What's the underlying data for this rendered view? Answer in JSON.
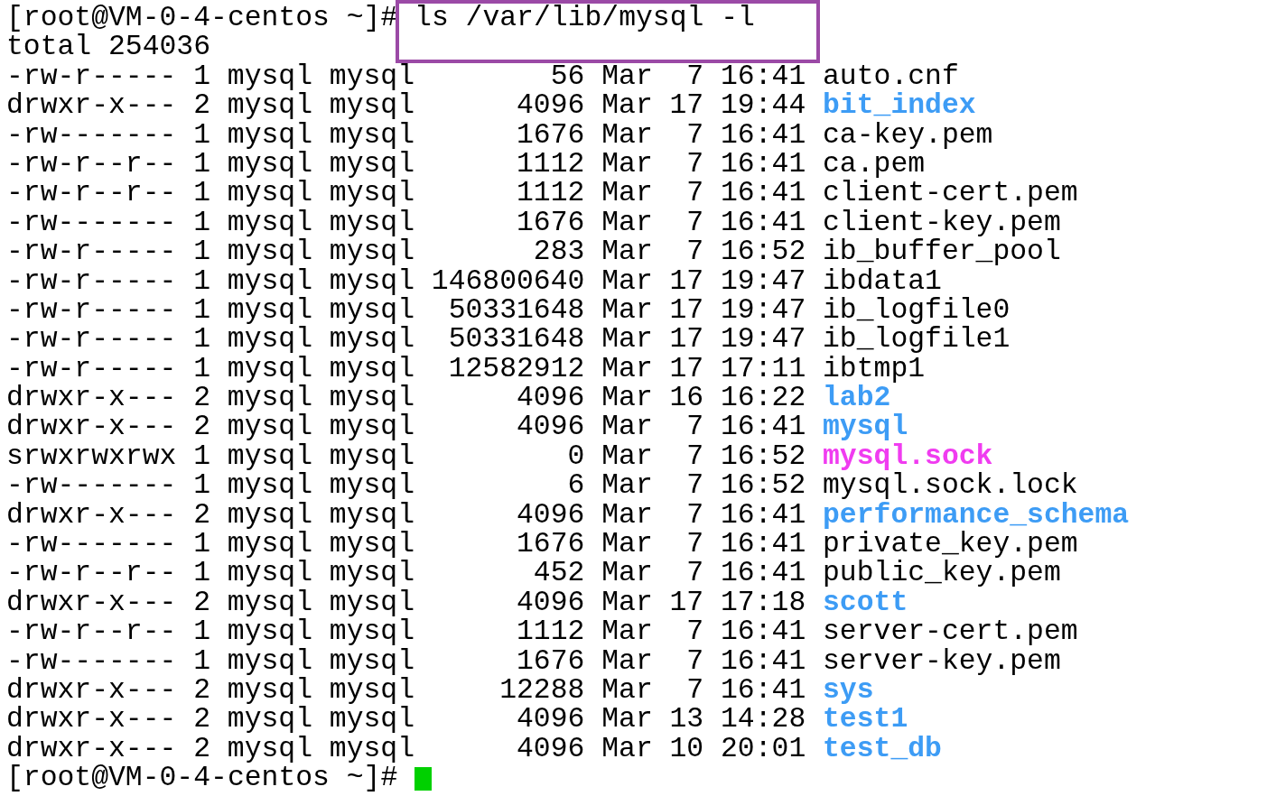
{
  "command_line": {
    "prompt": "[root@VM-0-4-centos ~]#",
    "command": "ls /var/lib/mysql -l",
    "highlighted": true
  },
  "total": "total 254036",
  "entries": [
    {
      "perms": "-rw-r-----",
      "links": "1",
      "owner": "mysql",
      "group": "mysql",
      "size": "56",
      "month": "Mar",
      "day": "7",
      "time": "16:41",
      "name": "auto.cnf",
      "kind": "file"
    },
    {
      "perms": "drwxr-x---",
      "links": "2",
      "owner": "mysql",
      "group": "mysql",
      "size": "4096",
      "month": "Mar",
      "day": "17",
      "time": "19:44",
      "name": "bit_index",
      "kind": "dir"
    },
    {
      "perms": "-rw-------",
      "links": "1",
      "owner": "mysql",
      "group": "mysql",
      "size": "1676",
      "month": "Mar",
      "day": "7",
      "time": "16:41",
      "name": "ca-key.pem",
      "kind": "file"
    },
    {
      "perms": "-rw-r--r--",
      "links": "1",
      "owner": "mysql",
      "group": "mysql",
      "size": "1112",
      "month": "Mar",
      "day": "7",
      "time": "16:41",
      "name": "ca.pem",
      "kind": "file"
    },
    {
      "perms": "-rw-r--r--",
      "links": "1",
      "owner": "mysql",
      "group": "mysql",
      "size": "1112",
      "month": "Mar",
      "day": "7",
      "time": "16:41",
      "name": "client-cert.pem",
      "kind": "file"
    },
    {
      "perms": "-rw-------",
      "links": "1",
      "owner": "mysql",
      "group": "mysql",
      "size": "1676",
      "month": "Mar",
      "day": "7",
      "time": "16:41",
      "name": "client-key.pem",
      "kind": "file"
    },
    {
      "perms": "-rw-r-----",
      "links": "1",
      "owner": "mysql",
      "group": "mysql",
      "size": "283",
      "month": "Mar",
      "day": "7",
      "time": "16:52",
      "name": "ib_buffer_pool",
      "kind": "file"
    },
    {
      "perms": "-rw-r-----",
      "links": "1",
      "owner": "mysql",
      "group": "mysql",
      "size": "146800640",
      "month": "Mar",
      "day": "17",
      "time": "19:47",
      "name": "ibdata1",
      "kind": "file"
    },
    {
      "perms": "-rw-r-----",
      "links": "1",
      "owner": "mysql",
      "group": "mysql",
      "size": "50331648",
      "month": "Mar",
      "day": "17",
      "time": "19:47",
      "name": "ib_logfile0",
      "kind": "file"
    },
    {
      "perms": "-rw-r-----",
      "links": "1",
      "owner": "mysql",
      "group": "mysql",
      "size": "50331648",
      "month": "Mar",
      "day": "17",
      "time": "19:47",
      "name": "ib_logfile1",
      "kind": "file"
    },
    {
      "perms": "-rw-r-----",
      "links": "1",
      "owner": "mysql",
      "group": "mysql",
      "size": "12582912",
      "month": "Mar",
      "day": "17",
      "time": "17:11",
      "name": "ibtmp1",
      "kind": "file"
    },
    {
      "perms": "drwxr-x---",
      "links": "2",
      "owner": "mysql",
      "group": "mysql",
      "size": "4096",
      "month": "Mar",
      "day": "16",
      "time": "16:22",
      "name": "lab2",
      "kind": "dir"
    },
    {
      "perms": "drwxr-x---",
      "links": "2",
      "owner": "mysql",
      "group": "mysql",
      "size": "4096",
      "month": "Mar",
      "day": "7",
      "time": "16:41",
      "name": "mysql",
      "kind": "dir"
    },
    {
      "perms": "srwxrwxrwx",
      "links": "1",
      "owner": "mysql",
      "group": "mysql",
      "size": "0",
      "month": "Mar",
      "day": "7",
      "time": "16:52",
      "name": "mysql.sock",
      "kind": "socket"
    },
    {
      "perms": "-rw-------",
      "links": "1",
      "owner": "mysql",
      "group": "mysql",
      "size": "6",
      "month": "Mar",
      "day": "7",
      "time": "16:52",
      "name": "mysql.sock.lock",
      "kind": "file"
    },
    {
      "perms": "drwxr-x---",
      "links": "2",
      "owner": "mysql",
      "group": "mysql",
      "size": "4096",
      "month": "Mar",
      "day": "7",
      "time": "16:41",
      "name": "performance_schema",
      "kind": "dir"
    },
    {
      "perms": "-rw-------",
      "links": "1",
      "owner": "mysql",
      "group": "mysql",
      "size": "1676",
      "month": "Mar",
      "day": "7",
      "time": "16:41",
      "name": "private_key.pem",
      "kind": "file"
    },
    {
      "perms": "-rw-r--r--",
      "links": "1",
      "owner": "mysql",
      "group": "mysql",
      "size": "452",
      "month": "Mar",
      "day": "7",
      "time": "16:41",
      "name": "public_key.pem",
      "kind": "file"
    },
    {
      "perms": "drwxr-x---",
      "links": "2",
      "owner": "mysql",
      "group": "mysql",
      "size": "4096",
      "month": "Mar",
      "day": "17",
      "time": "17:18",
      "name": "scott",
      "kind": "dir"
    },
    {
      "perms": "-rw-r--r--",
      "links": "1",
      "owner": "mysql",
      "group": "mysql",
      "size": "1112",
      "month": "Mar",
      "day": "7",
      "time": "16:41",
      "name": "server-cert.pem",
      "kind": "file"
    },
    {
      "perms": "-rw-------",
      "links": "1",
      "owner": "mysql",
      "group": "mysql",
      "size": "1676",
      "month": "Mar",
      "day": "7",
      "time": "16:41",
      "name": "server-key.pem",
      "kind": "file"
    },
    {
      "perms": "drwxr-x---",
      "links": "2",
      "owner": "mysql",
      "group": "mysql",
      "size": "12288",
      "month": "Mar",
      "day": "7",
      "time": "16:41",
      "name": "sys",
      "kind": "dir"
    },
    {
      "perms": "drwxr-x---",
      "links": "2",
      "owner": "mysql",
      "group": "mysql",
      "size": "4096",
      "month": "Mar",
      "day": "13",
      "time": "14:28",
      "name": "test1",
      "kind": "dir"
    },
    {
      "perms": "drwxr-x---",
      "links": "2",
      "owner": "mysql",
      "group": "mysql",
      "size": "4096",
      "month": "Mar",
      "day": "10",
      "time": "20:01",
      "name": "test_db",
      "kind": "dir"
    }
  ],
  "final_prompt": {
    "prompt": "[root@VM-0-4-centos ~]#",
    "cursor": true
  }
}
